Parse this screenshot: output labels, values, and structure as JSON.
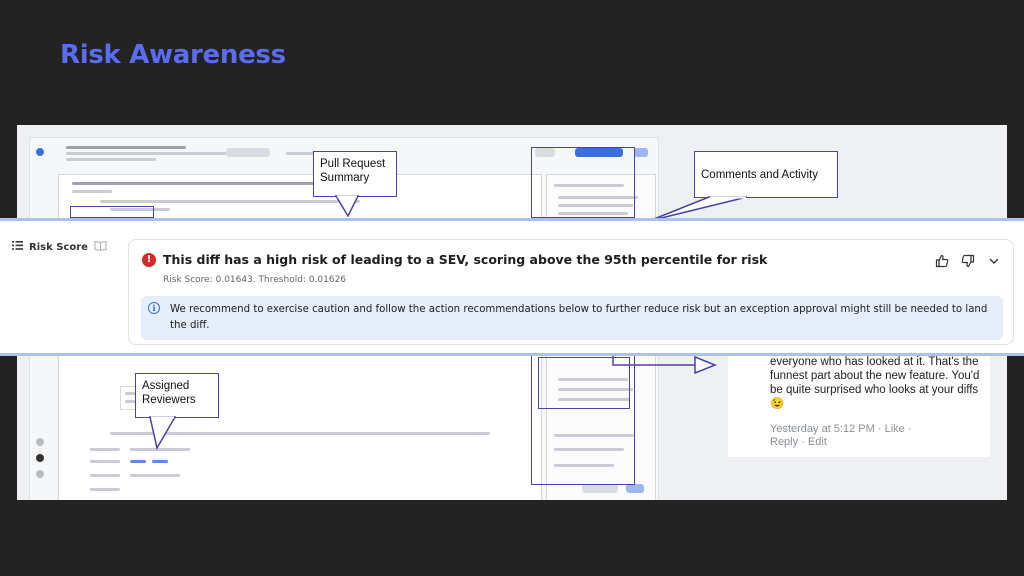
{
  "slide": {
    "title": "Risk Awareness"
  },
  "callouts": {
    "pull_request_summary": "Pull Request\nSummary",
    "comments_and_activity": "Comments and Activity",
    "assigned_reviewers": "Assigned\nReviewers"
  },
  "comment_snippet": {
    "text": "everyone who has looked at it.  That's the funnest part about the new feature.  You'd be quite surprised who looks at your diffs",
    "emoji": "😉",
    "timestamp": "Yesterday at 5:12 PM",
    "like_label": "Like",
    "reply_label": "Reply",
    "edit_label": "Edit"
  },
  "risk_score": {
    "section_label": "Risk Score",
    "headline": "This diff has a high risk of leading to a SEV, scoring above the 95th percentile for risk",
    "score_line": "Risk Score: 0.01643. Threshold: 0.01626",
    "recommendation": "We recommend to exercise caution and follow the action recommendations below to further reduce risk but an exception approval might still be needed to land the diff.",
    "warning_glyph": "!",
    "info_glyph": "i"
  },
  "icons": {
    "list": "list-icon",
    "book": "book-icon",
    "thumbs_up": "thumbs-up-icon",
    "thumbs_down": "thumbs-down-icon",
    "chevron": "chevron-down-icon"
  },
  "colors": {
    "title": "#5a6cf0",
    "annotation": "#4a42a8",
    "danger": "#d22a2a",
    "info_bg": "#e6eefb",
    "band_border": "#a9c2ee"
  }
}
